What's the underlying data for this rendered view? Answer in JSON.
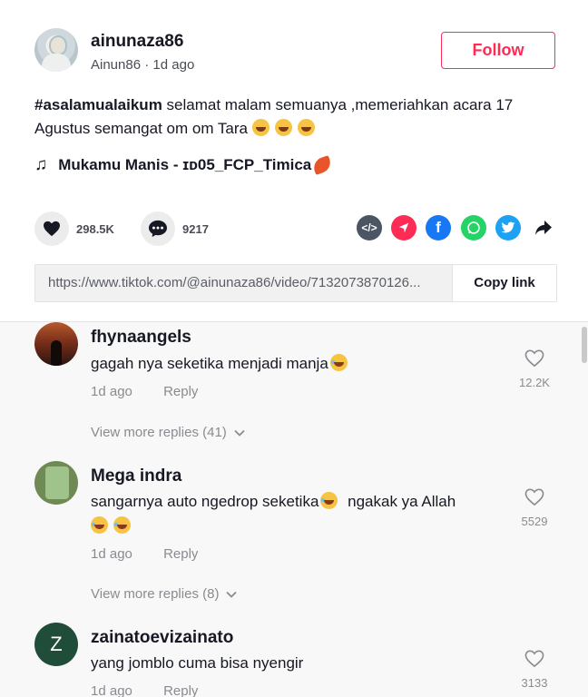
{
  "post": {
    "username": "ainunaza86",
    "nickname": "Ainun86",
    "time": "1d ago",
    "follow_label": "Follow",
    "hashtag": "#asalamualaikum",
    "description": " selamat malam semuanya ,memeriahkan acara 17 Agustus semangat om om Tara ",
    "music": "Mukamu Manis - ɪᴅ05_FCP_Timica",
    "likes": "298.5K",
    "comments": "9217",
    "link": "https://www.tiktok.com/@ainunaza86/video/7132073870126...",
    "copy_label": "Copy link"
  },
  "colors": {
    "accent": "#fe2c55",
    "embed": "#4b5563",
    "send": "#fe2c55",
    "facebook": "#1877f2",
    "whatsapp": "#25d366",
    "twitter": "#1da1f2"
  },
  "comments": [
    {
      "name": "fhynaangels",
      "text": "gagah nya seketika menjadi manja",
      "time": "1d ago",
      "reply": "Reply",
      "likes": "12.2K",
      "more": "View more replies (41)"
    },
    {
      "name": "Mega indra",
      "text": "sangarnya auto ngedrop seketika",
      "text2": " ngakak ya Allah",
      "time": "1d ago",
      "reply": "Reply",
      "likes": "5529",
      "more": "View more replies (8)"
    },
    {
      "name": "zainatoevizainato",
      "avatar_letter": "Z",
      "text": "yang jomblo cuma bisa nyengir",
      "time": "1d ago",
      "reply": "Reply",
      "likes": "3133"
    }
  ]
}
